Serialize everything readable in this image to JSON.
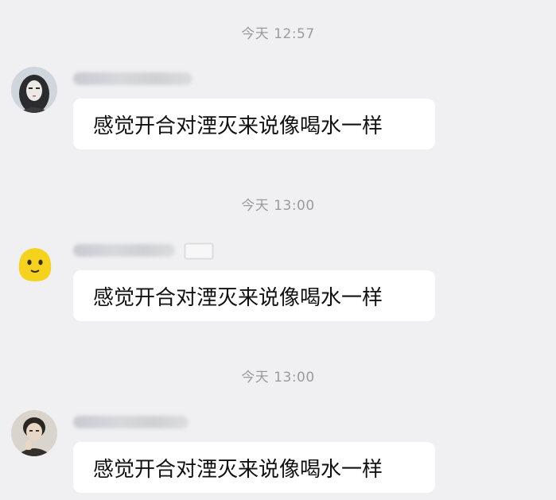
{
  "messages": [
    {
      "timestamp": "今天 12:57",
      "avatar_icon": "dark-haired-girl-avatar",
      "text": "感觉开合对湮灭来说像喝水一样",
      "has_level_tag": false
    },
    {
      "timestamp": "今天 13:00",
      "avatar_icon": "yellow-smiley-avatar",
      "text": "感觉开合对湮灭来说像喝水一样",
      "has_level_tag": true
    },
    {
      "timestamp": "今天 13:00",
      "avatar_icon": "person-photo-avatar",
      "text": "感觉开合对湮灭来说像喝水一样",
      "has_level_tag": false
    }
  ]
}
